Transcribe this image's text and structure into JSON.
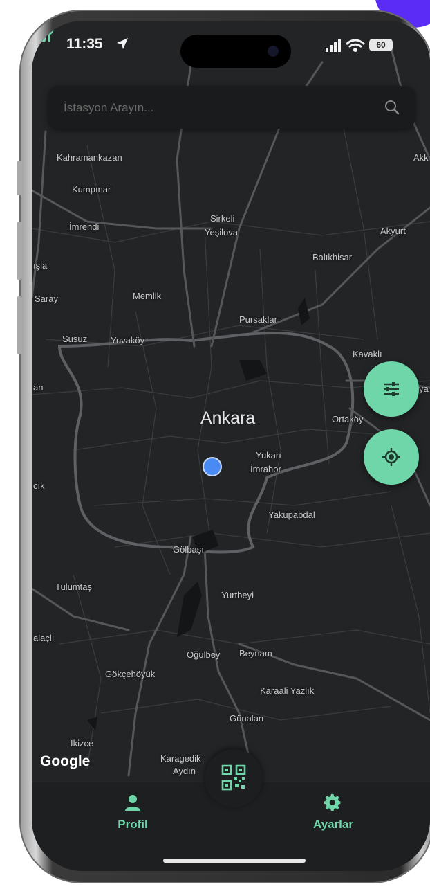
{
  "status_bar": {
    "time": "11:35",
    "battery": "60"
  },
  "search": {
    "placeholder": "İstasyon Arayın..."
  },
  "map": {
    "city": "Ankara",
    "places": [
      "Kahramankazan",
      "Kumpınar",
      "İmrendi",
      "Sirkeli",
      "Yeşilova",
      "Akyurt",
      "Balıkhisar",
      "Saray",
      "Memlik",
      "Pursaklar",
      "Susuz",
      "Yuvaköy",
      "Kavaklı",
      "Ortaköy",
      "Yukarı",
      "İmrahor",
      "Yakupabdal",
      "Gölbaşı",
      "Tulumtaş",
      "Yurtbeyi",
      "Oğulbey",
      "Beynam",
      "Gökçehöyük",
      "Karaali Yazlık",
      "Günalan",
      "İkizce",
      "Karagedik",
      "Aydın",
      "Akk",
      "ışla",
      "an",
      "cık",
      "alaçlı",
      "ya"
    ],
    "attribution": "Google"
  },
  "nav": {
    "profile_label": "Profil",
    "settings_label": "Ayarlar"
  },
  "colors": {
    "accent": "#6fd6aa",
    "map_background": "#232426",
    "user_location": "#4a8af4"
  }
}
